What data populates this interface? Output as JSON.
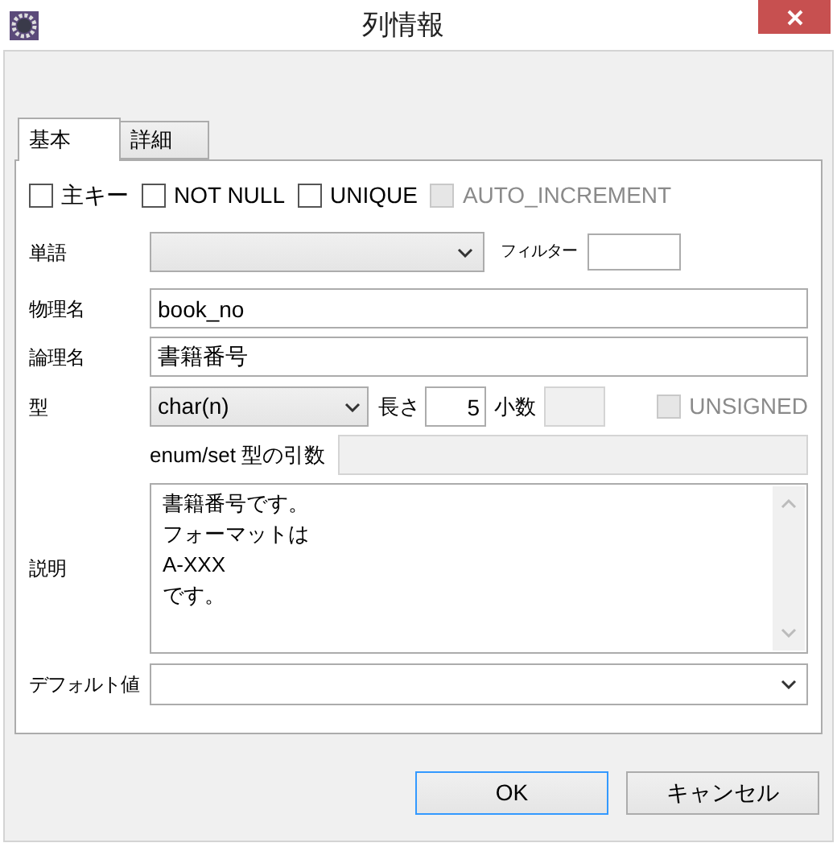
{
  "window": {
    "title": "列情報"
  },
  "tabs": [
    {
      "label": "基本",
      "selected": true
    },
    {
      "label": "詳細",
      "selected": false
    }
  ],
  "options": [
    {
      "label": "主キー",
      "checked": false,
      "disabled": false
    },
    {
      "label": "NOT NULL",
      "checked": false,
      "disabled": false
    },
    {
      "label": "UNIQUE",
      "checked": false,
      "disabled": false
    },
    {
      "label": "AUTO_INCREMENT",
      "checked": false,
      "disabled": true
    }
  ],
  "word": {
    "label": "単語"
  },
  "filter": {
    "label": "フィルター"
  },
  "physical_name": {
    "label": "物理名",
    "value": "book_no"
  },
  "logical_name": {
    "label": "論理名",
    "value": "書籍番号"
  },
  "type": {
    "label": "型",
    "value": "char(n)"
  },
  "length": {
    "label": "長さ",
    "value": "5"
  },
  "scale": {
    "label": "小数",
    "disabled": true
  },
  "unsigned": {
    "label": "UNSIGNED",
    "checked": false,
    "disabled": true
  },
  "enum_args": {
    "label": "enum/set 型の引数",
    "disabled": true
  },
  "description": {
    "label": "説明",
    "lines": [
      "書籍番号です。",
      "フォーマットは",
      "A-XXX",
      "です。"
    ]
  },
  "default_value": {
    "label": "デフォルト値"
  },
  "buttons": [
    {
      "label": "OK",
      "default": true
    },
    {
      "label": "キャンセル",
      "default": false
    }
  ]
}
